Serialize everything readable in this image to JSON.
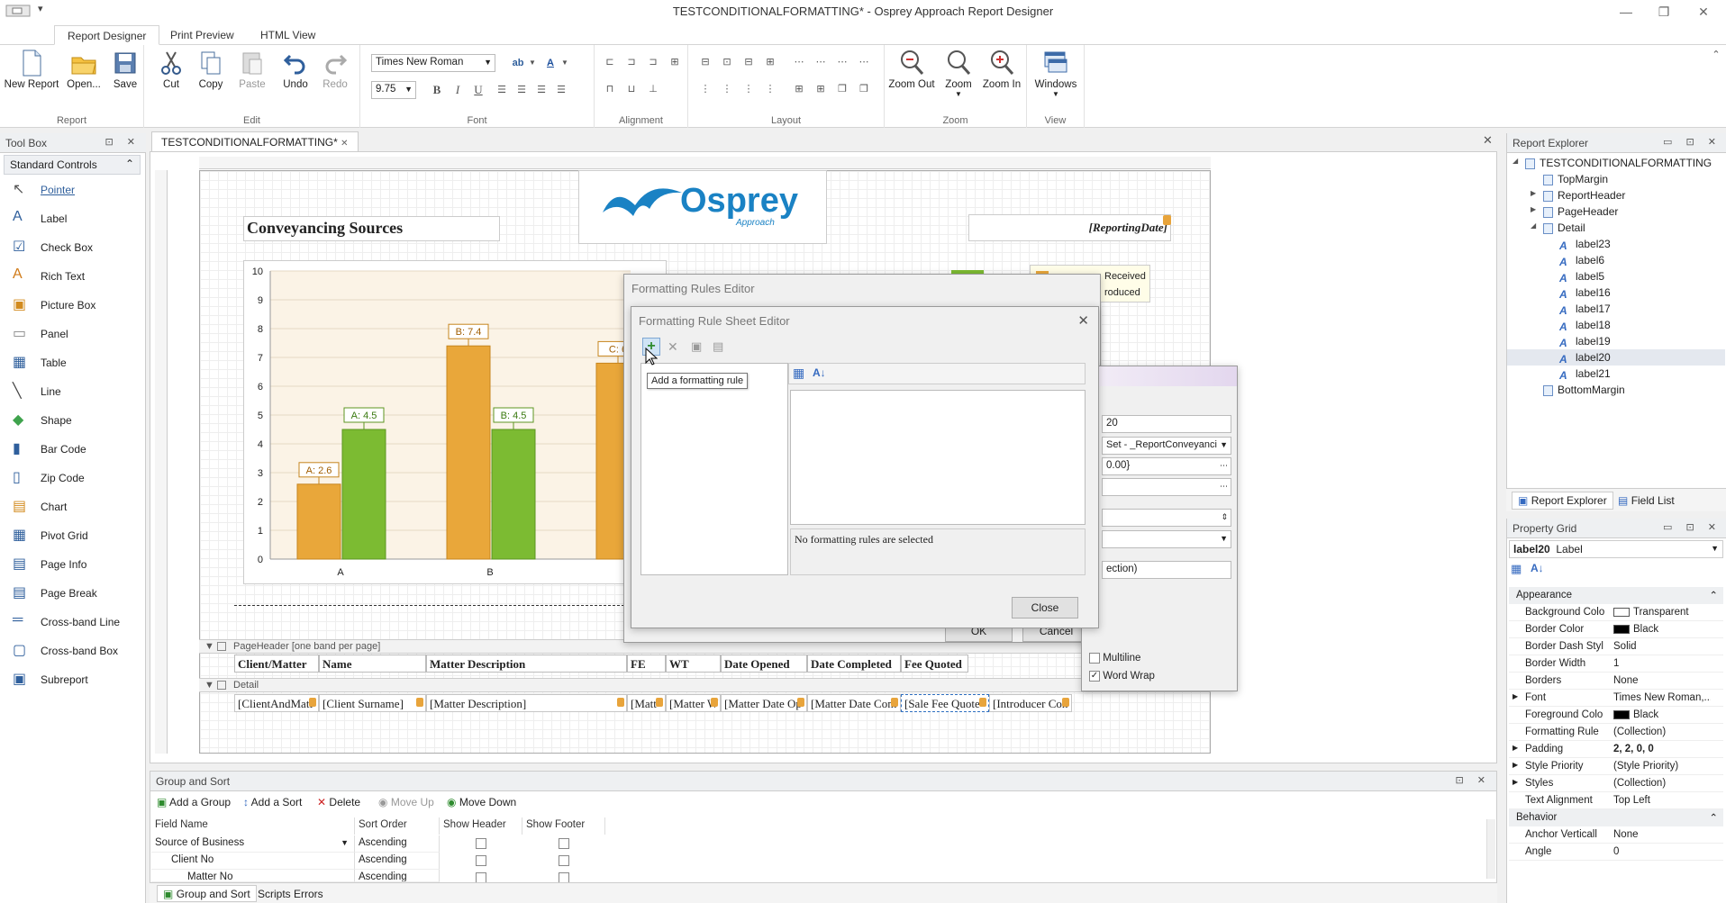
{
  "window": {
    "title": "TESTCONDITIONALFORMATTING* - Osprey Approach Report Designer"
  },
  "ribbon": {
    "tabs": [
      "Report Designer",
      "Print Preview",
      "HTML View"
    ],
    "report_group": {
      "label": "Report",
      "new": "New Report",
      "open": "Open...",
      "save": "Save"
    },
    "edit_group": {
      "label": "Edit",
      "cut": "Cut",
      "copy": "Copy",
      "paste": "Paste",
      "undo": "Undo",
      "redo": "Redo"
    },
    "font_group": {
      "label": "Font",
      "font_name": "Times New Roman",
      "font_size": "9.75",
      "bold": "B",
      "italic": "I",
      "underline": "U"
    },
    "alignment_group": {
      "label": "Alignment"
    },
    "layout_group": {
      "label": "Layout"
    },
    "zoom_group": {
      "label": "Zoom",
      "zoom_out": "Zoom Out",
      "zoom": "Zoom",
      "zoom_in": "Zoom In"
    },
    "view_group": {
      "label": "View",
      "windows": "Windows"
    }
  },
  "toolbox": {
    "title": "Tool Box",
    "category": "Standard Controls",
    "items": [
      "Pointer",
      "Label",
      "Check Box",
      "Rich Text",
      "Picture Box",
      "Panel",
      "Table",
      "Line",
      "Shape",
      "Bar Code",
      "Zip Code",
      "Chart",
      "Pivot Grid",
      "Page Info",
      "Page Break",
      "Cross-band Line",
      "Cross-band Box",
      "Subreport"
    ]
  },
  "designer": {
    "doc_tab": "TESTCONDITIONALFORMATTING*",
    "report_title": "Conveyancing Sources",
    "logo_text": "Osprey",
    "logo_sub": "Approach",
    "reporting_date": "[ReportingDate]",
    "legend": [
      "Received",
      "roduced"
    ],
    "pageheader_band": "PageHeader [one band per page]",
    "detail_band": "Detail",
    "headers": [
      "Client/Matter",
      "Name",
      "Matter Description",
      "FE",
      "WT",
      "Date Opened",
      "Date Completed",
      "Fee Quoted"
    ],
    "detail_cells": [
      "[ClientAndMatt",
      "[Client Surname]",
      "[Matter Description]",
      "[Matt",
      "[Matter W",
      "[Matter Date Op",
      "[Matter Date Com",
      "[Sale Fee Quote",
      "[Introducer Con"
    ]
  },
  "chart_data": {
    "type": "bar",
    "categories": [
      "A",
      "B",
      "C"
    ],
    "series": [
      {
        "values": [
          2.6,
          7.4,
          6.8
        ],
        "color": "#e9a73a"
      },
      {
        "values": [
          4.5,
          4.5,
          null
        ],
        "color": "#7cbb32"
      }
    ],
    "data_labels": [
      "A: 2.6",
      "A: 4.5",
      "B: 7.4",
      "B: 4.5",
      "C: 6"
    ],
    "y_ticks": [
      "0",
      "1",
      "2",
      "3",
      "4",
      "5",
      "6",
      "7",
      "8",
      "9",
      "10"
    ],
    "ylim": [
      0,
      10
    ],
    "grid": true
  },
  "formatting_rules_editor": {
    "title": "Formatting Rules Editor",
    "fields": [
      "20",
      "Set - _ReportConveyanci",
      "0.00}",
      "ection)"
    ],
    "multiline": "Multiline",
    "word_wrap": "Word Wrap",
    "ok": "OK",
    "cancel": "Cancel"
  },
  "rule_sheet_editor": {
    "title": "Formatting Rule Sheet Editor",
    "tooltip": "Add a formatting rule",
    "no_rules": "No formatting rules are selected",
    "close": "Close"
  },
  "report_explorer": {
    "title": "Report Explorer",
    "root": "TESTCONDITIONALFORMATTING",
    "bands": [
      "TopMargin",
      "ReportHeader",
      "PageHeader",
      "Detail"
    ],
    "labels": [
      "label23",
      "label6",
      "label5",
      "label16",
      "label17",
      "label18",
      "label19",
      "label20",
      "label21"
    ],
    "bottom": "BottomMargin",
    "selected": "label20",
    "tabs": [
      "Report Explorer",
      "Field List"
    ]
  },
  "property_grid": {
    "title": "Property Grid",
    "selected_name": "label20",
    "selected_type": "Label",
    "categories": [
      "Appearance",
      "Behavior"
    ],
    "appearance": [
      {
        "k": "Background Colo",
        "v": "Transparent",
        "swatch": "#ffffff"
      },
      {
        "k": "Border Color",
        "v": "Black",
        "swatch": "#000000"
      },
      {
        "k": "Border Dash Styl",
        "v": "Solid"
      },
      {
        "k": "Border Width",
        "v": "1"
      },
      {
        "k": "Borders",
        "v": "None"
      },
      {
        "k": "Font",
        "v": "Times New Roman,...",
        "expand": true
      },
      {
        "k": "Foreground Colo",
        "v": "Black",
        "swatch": "#000000"
      },
      {
        "k": "Formatting Rule",
        "v": "(Collection)"
      },
      {
        "k": "Padding",
        "v": "2, 2, 0, 0",
        "expand": true,
        "bold": true
      },
      {
        "k": "Style Priority",
        "v": "(Style Priority)",
        "expand": true
      },
      {
        "k": "Styles",
        "v": "(Collection)",
        "expand": true
      },
      {
        "k": "Text Alignment",
        "v": "Top Left"
      }
    ],
    "behavior": [
      {
        "k": "Anchor Verticall",
        "v": "None"
      },
      {
        "k": "Angle",
        "v": "0"
      }
    ]
  },
  "group_sort": {
    "title": "Group and Sort",
    "toolbar": [
      "Add a Group",
      "Add a Sort",
      "Delete",
      "Move Up",
      "Move Down"
    ],
    "columns": [
      "Field Name",
      "Sort Order",
      "Show Header",
      "Show Footer"
    ],
    "rows": [
      {
        "field": "Source of Business",
        "order": "Ascending"
      },
      {
        "field": "Client No",
        "order": "Ascending"
      },
      {
        "field": "Matter No",
        "order": "Ascending"
      }
    ],
    "bottom_tabs": [
      "Group and Sort",
      "Scripts Errors"
    ]
  }
}
